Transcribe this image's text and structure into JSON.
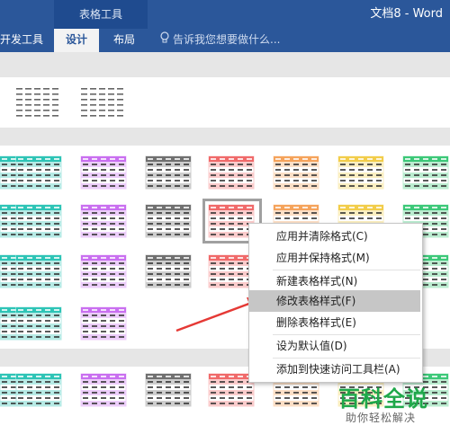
{
  "window": {
    "context_group": "表格工具",
    "doc_title": "文档8 - Word"
  },
  "tabs": [
    {
      "label": "开发工具",
      "active": false
    },
    {
      "label": "设计",
      "active": true
    },
    {
      "label": "布局",
      "active": false
    }
  ],
  "tell_me": {
    "text": "告诉我您想要做什么..."
  },
  "colors": {
    "ribbon": "#2b579a",
    "teal": "#2ec4b6",
    "purple": "#c96ff0",
    "gray": "#707070",
    "red": "#f06a6a",
    "orange": "#f5a35b",
    "yellow": "#f2cd4a",
    "green": "#3cc878",
    "selection_border": "#a0a0a0"
  },
  "gallery": {
    "plain_row": [
      "plain",
      "plain"
    ],
    "row1": [
      "teal",
      "teal",
      "purple",
      "gray",
      "red",
      "orange",
      "yellow",
      "green"
    ],
    "row2": [
      "teal",
      "teal",
      "purple",
      "gray",
      "red",
      "orange",
      "yellow",
      "green"
    ],
    "row3": [
      "teal",
      "teal",
      "purple",
      "gray",
      "red",
      "orange",
      "yellow",
      "green"
    ],
    "row4": [
      "teal",
      "teal",
      "purple"
    ],
    "row5": [
      "teal",
      "teal",
      "purple",
      "gray",
      "red",
      "orange",
      "yellow",
      "green"
    ],
    "selected_row": 2,
    "selected_col": 4
  },
  "context_menu": {
    "items": [
      {
        "label": "应用并清除格式(C)",
        "highlighted": false
      },
      {
        "label": "应用并保持格式(M)",
        "highlighted": false
      },
      {
        "label": "新建表格样式(N)",
        "highlighted": false
      },
      {
        "label": "修改表格样式(F)",
        "highlighted": true
      },
      {
        "label": "删除表格样式(E)",
        "highlighted": false
      },
      {
        "label": "设为默认值(D)",
        "highlighted": false
      },
      {
        "label": "添加到快速访问工具栏(A)",
        "highlighted": false
      }
    ]
  },
  "watermark": {
    "main": "百科全说",
    "sub": "助你轻松解决"
  }
}
